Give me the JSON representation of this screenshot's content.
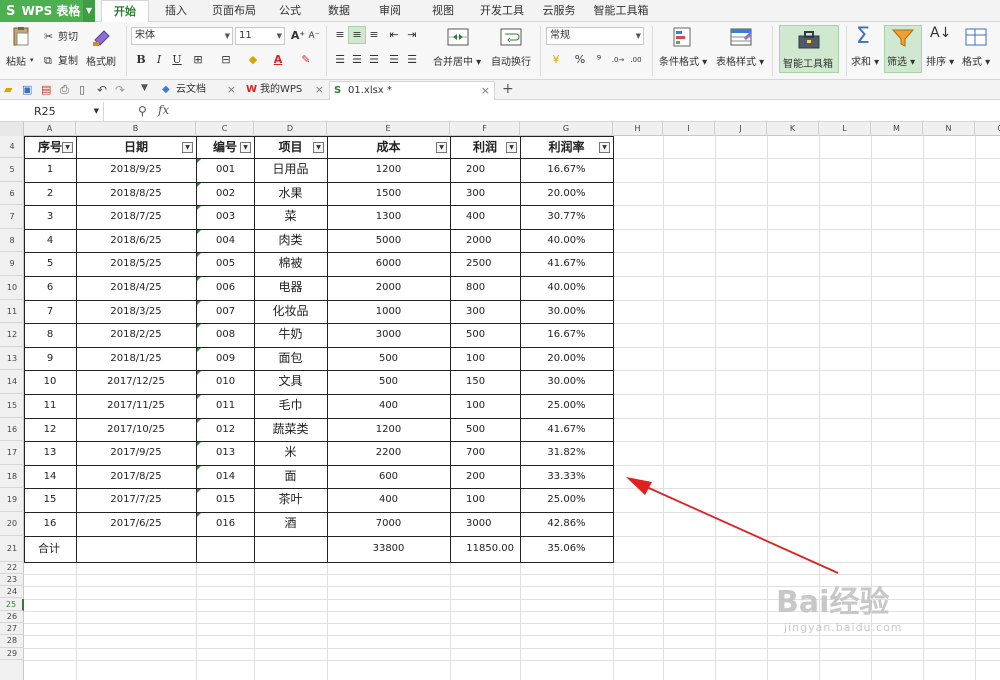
{
  "app": {
    "title": "WPS 表格",
    "logo": "S"
  },
  "tabs": [
    {
      "label": "开始",
      "active": true
    },
    {
      "label": "插入"
    },
    {
      "label": "页面布局"
    },
    {
      "label": "公式"
    },
    {
      "label": "数据"
    },
    {
      "label": "审阅"
    },
    {
      "label": "视图"
    },
    {
      "label": "开发工具"
    },
    {
      "label": "云服务"
    },
    {
      "label": "智能工具箱"
    }
  ],
  "ribbon": {
    "paste": "粘贴",
    "cut": "剪切",
    "copy": "复制",
    "format_painter": "格式刷",
    "font_name": "宋体",
    "font_size": "11",
    "bold": "B",
    "italic": "I",
    "underline": "U",
    "merge_center": "合并居中",
    "wrap_text": "自动换行",
    "number_format": "常规",
    "percent": "%",
    "thousands": "⁹",
    "conditional_format": "条件格式",
    "table_style": "表格样式",
    "smart_toolbox": "智能工具箱",
    "sum": "求和",
    "filter": "筛选",
    "sort": "排序",
    "format": "格式"
  },
  "quickbar": {
    "doc_tabs": [
      {
        "label": "云文档",
        "icon": "cloud-doc-icon"
      },
      {
        "label": "我的WPS",
        "icon": "wps-w-icon"
      },
      {
        "label": "01.xlsx *",
        "icon": "excel-file-icon",
        "active": true
      }
    ],
    "add_tab": "+"
  },
  "formula_bar": {
    "cell_ref": "R25",
    "fx": "fx",
    "value": ""
  },
  "columns": [
    "A",
    "B",
    "C",
    "D",
    "E",
    "F",
    "G",
    "H",
    "I",
    "J",
    "K",
    "L",
    "M",
    "N",
    "O"
  ],
  "row_numbers": [
    "4",
    "5",
    "6",
    "7",
    "8",
    "9",
    "10",
    "11",
    "12",
    "13",
    "14",
    "15",
    "16",
    "17",
    "18",
    "19",
    "20",
    "21",
    "22",
    "23",
    "24",
    "25",
    "26",
    "27",
    "28",
    "29"
  ],
  "active_row": "25",
  "table": {
    "headers": [
      "序号",
      "日期",
      "编号",
      "项目",
      "成本",
      "利润",
      "利润率"
    ],
    "rows": [
      [
        "1",
        "2018/9/25",
        "001",
        "日用品",
        "1200",
        "200",
        "16.67%"
      ],
      [
        "2",
        "2018/8/25",
        "002",
        "水果",
        "1500",
        "300",
        "20.00%"
      ],
      [
        "3",
        "2018/7/25",
        "003",
        "菜",
        "1300",
        "400",
        "30.77%"
      ],
      [
        "4",
        "2018/6/25",
        "004",
        "肉类",
        "5000",
        "2000",
        "40.00%"
      ],
      [
        "5",
        "2018/5/25",
        "005",
        "棉被",
        "6000",
        "2500",
        "41.67%"
      ],
      [
        "6",
        "2018/4/25",
        "006",
        "电器",
        "2000",
        "800",
        "40.00%"
      ],
      [
        "7",
        "2018/3/25",
        "007",
        "化妆品",
        "1000",
        "300",
        "30.00%"
      ],
      [
        "8",
        "2018/2/25",
        "008",
        "牛奶",
        "3000",
        "500",
        "16.67%"
      ],
      [
        "9",
        "2018/1/25",
        "009",
        "面包",
        "500",
        "100",
        "20.00%"
      ],
      [
        "10",
        "2017/12/25",
        "010",
        "文具",
        "500",
        "150",
        "30.00%"
      ],
      [
        "11",
        "2017/11/25",
        "011",
        "毛巾",
        "400",
        "100",
        "25.00%"
      ],
      [
        "12",
        "2017/10/25",
        "012",
        "蔬菜类",
        "1200",
        "500",
        "41.67%"
      ],
      [
        "13",
        "2017/9/25",
        "013",
        "米",
        "2200",
        "700",
        "31.82%"
      ],
      [
        "14",
        "2017/8/25",
        "014",
        "面",
        "600",
        "200",
        "33.33%"
      ],
      [
        "15",
        "2017/7/25",
        "015",
        "茶叶",
        "400",
        "100",
        "25.00%"
      ],
      [
        "16",
        "2017/6/25",
        "016",
        "酒",
        "7000",
        "3000",
        "42.86%"
      ]
    ],
    "total": [
      "合计",
      "",
      "",
      "",
      "33800",
      "11850.00",
      "35.06%"
    ]
  },
  "colors": {
    "accent": "#2e7d32",
    "app_green": "#4caf50",
    "arrow_red": "#e02020"
  },
  "watermark": {
    "main": "Bai经验",
    "sub": "jingyan.baidu.com"
  }
}
